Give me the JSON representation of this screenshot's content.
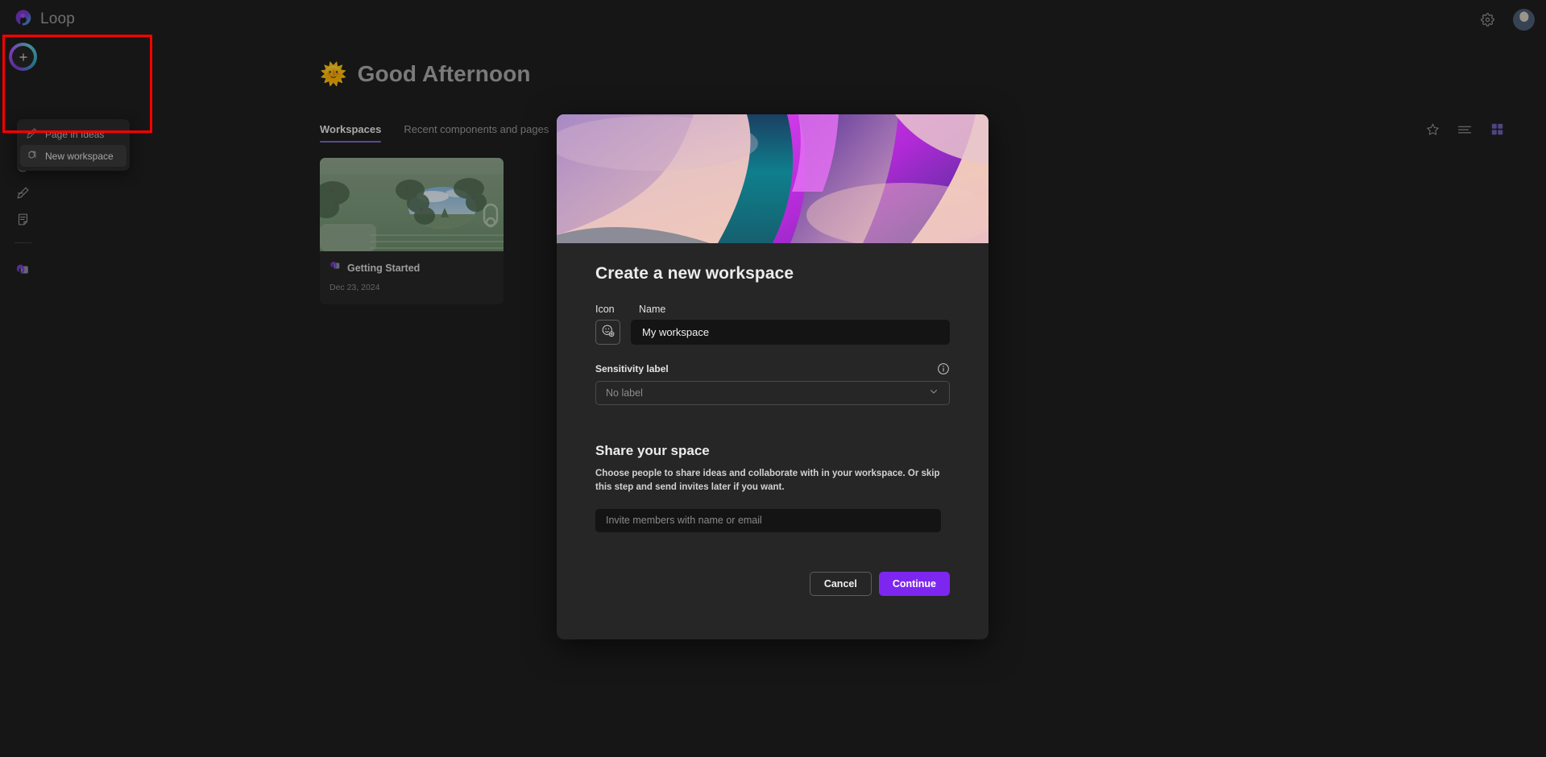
{
  "app": {
    "brand_name": "Loop",
    "logo_icon": "loop-logo-icon"
  },
  "topbar": {
    "settings_icon": "gear-icon",
    "avatar_name": "avatar"
  },
  "rail": {
    "add_button_icon": "plus-icon",
    "items": [
      {
        "icon": "bell-icon",
        "name": "notifications"
      },
      {
        "icon": "clock-icon",
        "name": "recent"
      },
      {
        "icon": "pen-icon",
        "name": "ideas"
      },
      {
        "icon": "notes-icon",
        "name": "notes"
      },
      {
        "icon": "workspace-icon",
        "name": "getting-started-workspace"
      }
    ]
  },
  "flyout": {
    "items": [
      {
        "label": "Page in Ideas",
        "icon": "pen-icon",
        "selected": false
      },
      {
        "label": "New workspace",
        "icon": "cube-icon",
        "selected": true
      }
    ]
  },
  "main": {
    "greeting_emoji": "🌞",
    "greeting_text": "Good Afternoon",
    "tabs": [
      {
        "label": "Workspaces",
        "active": true
      },
      {
        "label": "Recent components and pages",
        "active": false
      }
    ],
    "view_tools": [
      {
        "icon": "star-icon",
        "name": "favorites-toggle",
        "active": false
      },
      {
        "icon": "list-view-icon",
        "name": "list-view-toggle",
        "active": false
      },
      {
        "icon": "grid-view-icon",
        "name": "grid-view-toggle",
        "active": true
      }
    ],
    "cards": [
      {
        "title": "Getting Started",
        "date": "Dec 23, 2024",
        "icon": "workspace-icon"
      }
    ]
  },
  "modal": {
    "title": "Create a new workspace",
    "icon_label": "Icon",
    "name_label": "Name",
    "name_value": "My workspace",
    "icon_picker_icon": "emoji-add-icon",
    "sensitivity_label": "Sensitivity label",
    "sensitivity_info_icon": "info-icon",
    "sensitivity_value": "No label",
    "sensitivity_chevron": "chevron-down-icon",
    "share_title": "Share your space",
    "share_description": "Choose people to share ideas and collaborate with in your workspace. Or skip this step and send invites later if you want.",
    "invite_placeholder": "Invite members with name or email",
    "invite_value": "",
    "cancel_label": "Cancel",
    "continue_label": "Continue"
  },
  "colors": {
    "accent_purple": "#7d26f0",
    "tab_underline": "#7b68c9",
    "annotation_red": "#ff0000",
    "app_bg": "#1f1f1f",
    "modal_bg": "#262626"
  }
}
